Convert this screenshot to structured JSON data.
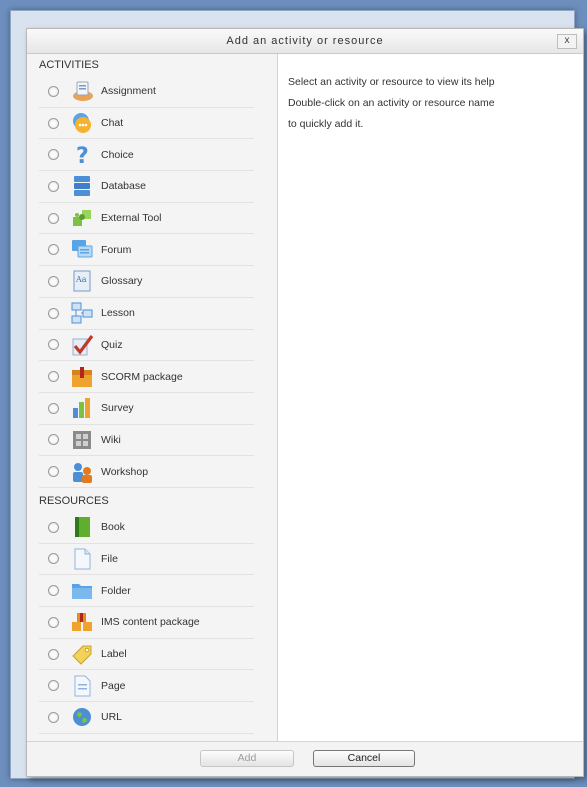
{
  "dialog": {
    "title": "Add an activity or resource",
    "close_label": "x"
  },
  "sections": {
    "activities_heading": "ACTIVITIES",
    "resources_heading": "RESOURCES"
  },
  "activities": [
    {
      "label": "Assignment",
      "icon": "assignment-icon"
    },
    {
      "label": "Chat",
      "icon": "chat-icon"
    },
    {
      "label": "Choice",
      "icon": "choice-icon"
    },
    {
      "label": "Database",
      "icon": "database-icon"
    },
    {
      "label": "External Tool",
      "icon": "external-tool-icon"
    },
    {
      "label": "Forum",
      "icon": "forum-icon"
    },
    {
      "label": "Glossary",
      "icon": "glossary-icon"
    },
    {
      "label": "Lesson",
      "icon": "lesson-icon"
    },
    {
      "label": "Quiz",
      "icon": "quiz-icon"
    },
    {
      "label": "SCORM package",
      "icon": "scorm-icon"
    },
    {
      "label": "Survey",
      "icon": "survey-icon"
    },
    {
      "label": "Wiki",
      "icon": "wiki-icon"
    },
    {
      "label": "Workshop",
      "icon": "workshop-icon"
    }
  ],
  "resources": [
    {
      "label": "Book",
      "icon": "book-icon"
    },
    {
      "label": "File",
      "icon": "file-icon"
    },
    {
      "label": "Folder",
      "icon": "folder-icon"
    },
    {
      "label": "IMS content package",
      "icon": "ims-package-icon"
    },
    {
      "label": "Label",
      "icon": "label-icon"
    },
    {
      "label": "Page",
      "icon": "page-icon"
    },
    {
      "label": "URL",
      "icon": "url-icon"
    }
  ],
  "help": {
    "line1": "Select an activity or resource to view its help",
    "line2": "Double-click on an activity or resource name",
    "line3": "to quickly add it."
  },
  "footer": {
    "add_label": "Add",
    "cancel_label": "Cancel"
  }
}
